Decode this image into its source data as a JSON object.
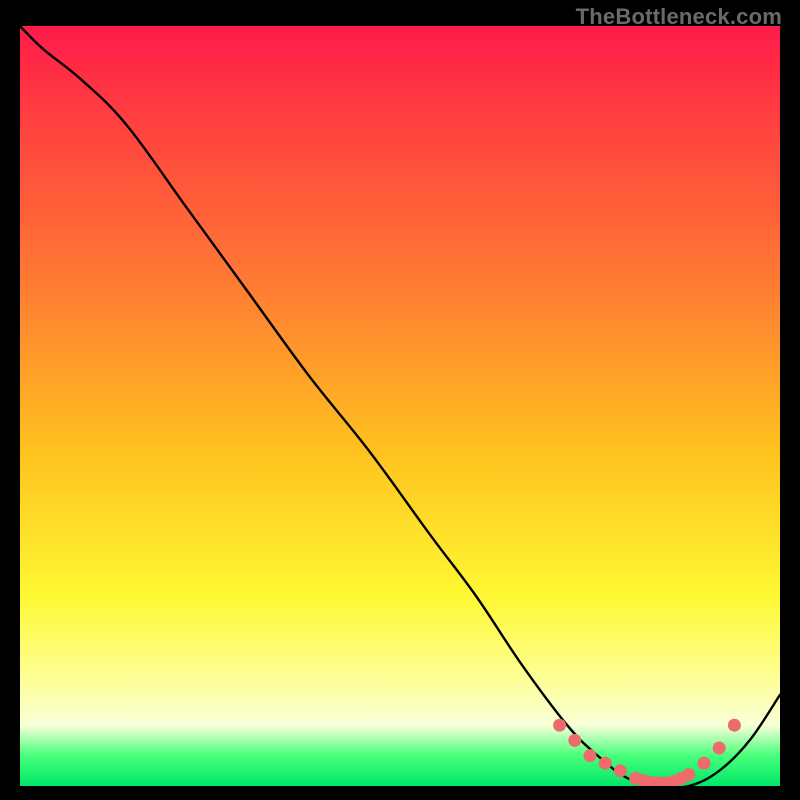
{
  "watermark": "TheBottleneck.com",
  "colors": {
    "curve_stroke": "#000000",
    "dot_fill": "#ef6b6b",
    "dot_stroke": "#c44848"
  },
  "chart_data": {
    "type": "line",
    "title": "",
    "xlabel": "",
    "ylabel": "",
    "xlim": [
      0,
      100
    ],
    "ylim": [
      0,
      100
    ],
    "grid": false,
    "series": [
      {
        "name": "bottleneck-curve",
        "x": [
          0,
          3,
          8,
          14,
          22,
          30,
          38,
          46,
          54,
          60,
          66,
          72,
          76,
          80,
          84,
          88,
          92,
          96,
          100
        ],
        "y": [
          100,
          97,
          93,
          87,
          76,
          65,
          54,
          44,
          33,
          25,
          16,
          8,
          4,
          1,
          0,
          0,
          2,
          6,
          12
        ]
      }
    ],
    "markers": {
      "name": "highlight-dots",
      "x": [
        71,
        73,
        75,
        77,
        79,
        81,
        82,
        83,
        84,
        85,
        86,
        87,
        88,
        90,
        92,
        94
      ],
      "y": [
        8,
        6,
        4,
        3,
        2,
        1,
        0.7,
        0.5,
        0.4,
        0.4,
        0.6,
        1,
        1.5,
        3,
        5,
        8
      ]
    }
  }
}
